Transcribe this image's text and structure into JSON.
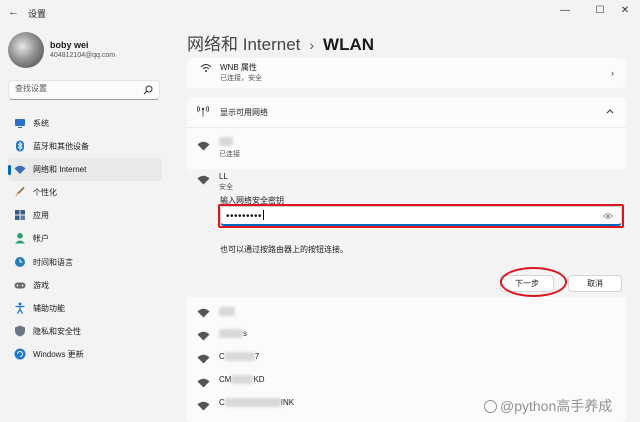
{
  "window": {
    "title": "设置",
    "minimize": "—",
    "maximize": "☐",
    "close": "✕"
  },
  "profile": {
    "name": "boby wei",
    "email": "404812104@qq.com"
  },
  "search": {
    "placeholder": "查找设置"
  },
  "nav": {
    "items": [
      {
        "label": "系统",
        "icon": "monitor-icon",
        "color": "#2b6fc6"
      },
      {
        "label": "蓝牙和其他设备",
        "icon": "bluetooth-icon",
        "color": "#1f78d1"
      },
      {
        "label": "网络和 Internet",
        "icon": "wifi-icon",
        "color": "#3a6fb5",
        "active": true
      },
      {
        "label": "个性化",
        "icon": "brush-icon",
        "color": "#d67d2a"
      },
      {
        "label": "应用",
        "icon": "apps-icon",
        "color": "#3b5e86"
      },
      {
        "label": "帐户",
        "icon": "person-icon",
        "color": "#2e9d6c"
      },
      {
        "label": "时间和语言",
        "icon": "globe-clock-icon",
        "color": "#2a7ab8"
      },
      {
        "label": "游戏",
        "icon": "gamepad-icon",
        "color": "#6a6a6a"
      },
      {
        "label": "辅助功能",
        "icon": "accessibility-icon",
        "color": "#1e7ad6"
      },
      {
        "label": "隐私和安全性",
        "icon": "shield-icon",
        "color": "#6b7785"
      },
      {
        "label": "Windows 更新",
        "icon": "update-icon",
        "color": "#1f78d1"
      }
    ]
  },
  "header": {
    "section": "网络和 Internet",
    "separator": "›",
    "current": "WLAN"
  },
  "wnb": {
    "name": "WNB 属性",
    "status": "已连接，安全"
  },
  "available": {
    "title": "显示可用网络",
    "networks": [
      {
        "name_visible": "",
        "status": "已连接"
      },
      {
        "name": "LL",
        "status": "安全",
        "expanded": true
      },
      {
        "name_suffix": ""
      },
      {
        "name_suffix": "s"
      },
      {
        "name_prefix": "C",
        "name_suffix": "7"
      },
      {
        "name_prefix": "CM",
        "name_suffix": "KD"
      },
      {
        "name_prefix": "C",
        "name_suffix": "INK"
      }
    ]
  },
  "password": {
    "label": "输入网络安全密钥",
    "value": "•••••••••",
    "hint": "也可以通过按路由器上的按钮连接。",
    "next_label": "下一步",
    "cancel_label": "取消"
  },
  "watermark": {
    "text": "@python高手养成"
  },
  "colors": {
    "accent": "#0067c0",
    "annotation": "#e0141e"
  }
}
